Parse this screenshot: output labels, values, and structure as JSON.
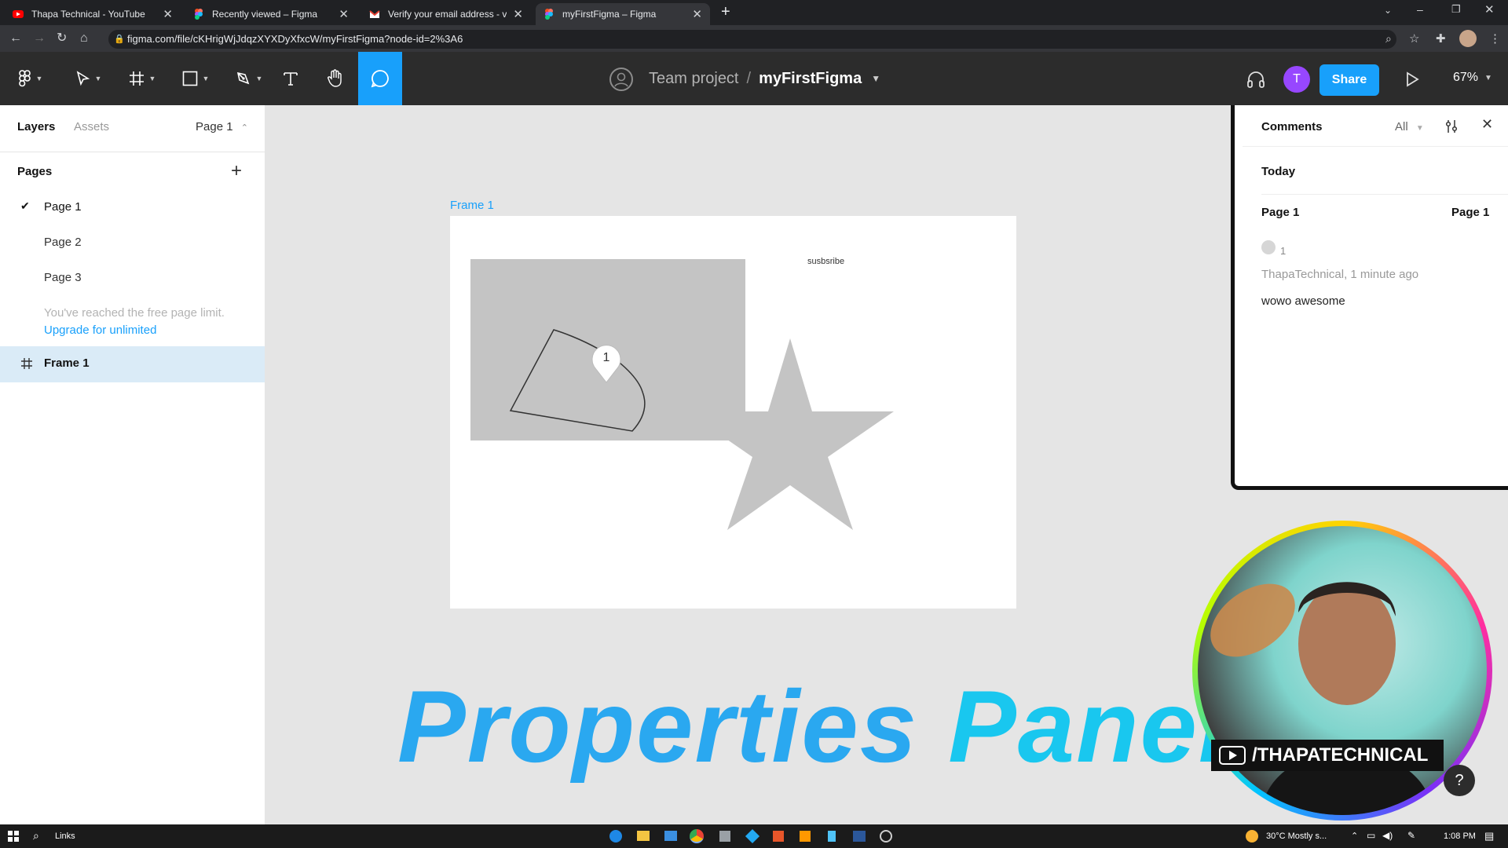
{
  "browser": {
    "tabs": [
      {
        "label": "Thapa Technical - YouTube",
        "icon": "youtube-icon",
        "color": "#ff0000"
      },
      {
        "label": "Recently viewed – Figma",
        "icon": "figma-icon",
        "color": "#a259ff"
      },
      {
        "label": "Verify your email address - vinod",
        "icon": "gmail-icon",
        "color": "#ea4335"
      },
      {
        "label": "myFirstFigma – Figma",
        "icon": "figma-icon",
        "color": "#a259ff"
      }
    ],
    "url": "figma.com/file/cKHrigWjJdqzXYXDyXfxcW/myFirstFigma?node-id=2%3A6"
  },
  "toolbar": {
    "team": "Team project",
    "separator": "/",
    "filename": "myFirstFigma",
    "avatar_initial": "T",
    "share_label": "Share",
    "zoom": "67%",
    "accent": "#18a0fb"
  },
  "leftpanel": {
    "tab_layers": "Layers",
    "tab_assets": "Assets",
    "current_page": "Page 1",
    "pages_title": "Pages",
    "pages": [
      "Page 1",
      "Page 2",
      "Page 3"
    ],
    "limit_note": "You've reached the free page limit.",
    "upgrade_link": "Upgrade for unlimited",
    "layer_frame": "Frame 1"
  },
  "canvas": {
    "frame_label": "Frame 1",
    "text_layer": "susbsribe",
    "comment_pin": "1"
  },
  "comments": {
    "title": "Comments",
    "filter": "All",
    "section": "Today",
    "page_left": "Page 1",
    "page_right": "Page 1",
    "number": "1",
    "author_time": "ThapaTechnical, 1 minute ago",
    "text": "wowo awesome"
  },
  "overlay": {
    "title_part1": "Properties",
    "title_part2": "Panel",
    "channel_handle": "/THAPATECHNICAL",
    "help": "?"
  },
  "taskbar": {
    "search_label": "Links",
    "weather": "30°C  Mostly s...",
    "time": "1:08 PM"
  }
}
